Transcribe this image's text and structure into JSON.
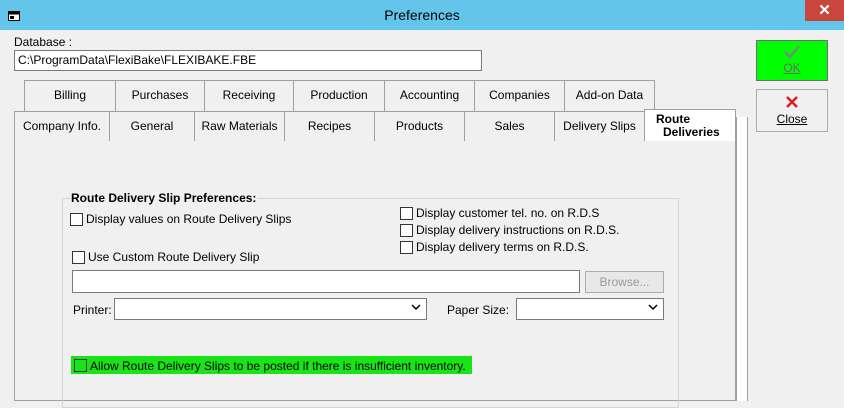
{
  "window": {
    "title": "Preferences",
    "close_symbol": "✕"
  },
  "database": {
    "label": "Database :",
    "value": "C:\\ProgramData\\FlexiBake\\FLEXIBAKE.FBE"
  },
  "tabs_row1": [
    "Billing",
    "Purchases",
    "Receiving",
    "Production",
    "Accounting",
    "Companies",
    "Add-on Data"
  ],
  "tabs_row2": [
    "Company Info.",
    "General",
    "Raw Materials",
    "Recipes",
    "Products",
    "Sales",
    "Delivery Slips"
  ],
  "active_tab": {
    "line1": "Route",
    "line2": "Deliveries"
  },
  "group": {
    "title": "Route Delivery Slip Preferences:",
    "display_values": "Display values on Route Delivery Slips",
    "display_tel": "Display customer tel. no. on R.D.S",
    "display_instructions": "Display delivery instructions on R.D.S.",
    "display_terms": "Display delivery terms on R.D.S.",
    "use_custom": "Use Custom Route Delivery Slip",
    "custom_path": "",
    "browse": "Browse...",
    "printer_label": "Printer:",
    "printer_value": "",
    "paper_label": "Paper Size:",
    "paper_value": "",
    "allow_insufficient": "Allow Route Delivery Slips to be posted if there is insufficient inventory."
  },
  "buttons": {
    "ok_label": "OK",
    "ok_icon": "checkmark-icon",
    "close_label": "Close",
    "close_icon": "red-x-icon"
  },
  "colors": {
    "titlebar": "#63c5e9",
    "ok_bg": "#00ff00",
    "highlight": "#18e418",
    "close_x": "#c9463d"
  }
}
